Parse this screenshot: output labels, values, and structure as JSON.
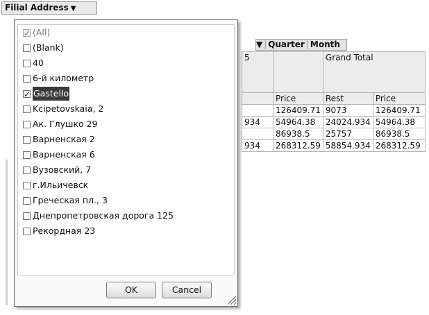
{
  "field_header": {
    "label": "Filial Address",
    "arrow": "▼"
  },
  "pivot": {
    "column_fields": [
      "▼",
      "Quarter",
      "Month"
    ],
    "partial_header": "5",
    "grand_total": "Grand Total",
    "measure_headers": [
      "Price",
      "Rest",
      "Price"
    ],
    "rows": [
      [
        "",
        "126409.71",
        "9073",
        "126409.71"
      ],
      [
        "934",
        "54964.38",
        "24024.934",
        "54964.38"
      ],
      [
        "",
        "86938.5",
        "25757",
        "86938.5"
      ],
      [
        "934",
        "268312.59",
        "58854.934",
        "268312.59"
      ]
    ]
  },
  "filter_popup": {
    "items": [
      {
        "label": "(All)",
        "checked": true,
        "disabled": true
      },
      {
        "label": "(Blank)",
        "checked": false
      },
      {
        "label": "40",
        "checked": false
      },
      {
        "label": "6-й километр",
        "checked": false
      },
      {
        "label": "Gastello",
        "checked": true,
        "selected": true
      },
      {
        "label": "Kcipetovskaia, 2",
        "checked": false
      },
      {
        "label": "Ак. Глушко 29",
        "checked": false
      },
      {
        "label": "Варненская 2",
        "checked": false
      },
      {
        "label": "Варненская 6",
        "checked": false
      },
      {
        "label": "Вузовский, 7",
        "checked": false
      },
      {
        "label": "г.Ильичевск",
        "checked": false
      },
      {
        "label": "Греческая пл., 3",
        "checked": false
      },
      {
        "label": "Днепропетровская дорога 125",
        "checked": false
      },
      {
        "label": "Рекордная 23",
        "checked": false
      }
    ],
    "ok_label": "OK",
    "cancel_label": "Cancel"
  }
}
